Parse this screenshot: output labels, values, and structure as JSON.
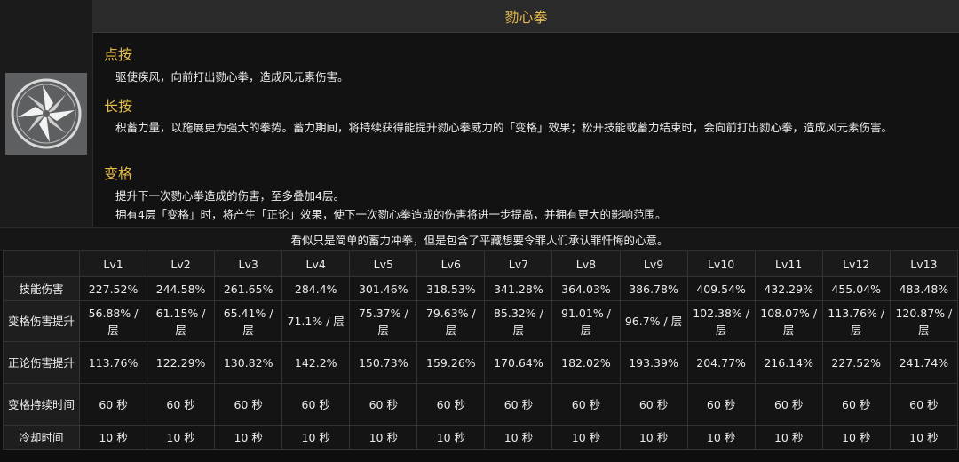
{
  "skill": {
    "title": "勠心拳",
    "sections": [
      {
        "heading": "点按",
        "lines": [
          "驱使疾风，向前打出勠心拳，造成风元素伤害。"
        ]
      },
      {
        "heading": "长按",
        "lines": [
          "积蓄力量，以施展更为强大的拳势。蓄力期间，将持续获得能提升勠心拳威力的「变格」效果；松开技能或蓄力结束时，会向前打出勠心拳，造成风元素伤害。"
        ]
      },
      {
        "heading": "变格",
        "lines": [
          "提升下一次勠心拳造成的伤害，至多叠加4层。",
          "拥有4层「变格」时，将产生「正论」效果，使下一次勠心拳造成的伤害将进一步提高，并拥有更大的影响范围。"
        ]
      }
    ],
    "icon": "wind-pinwheel-icon"
  },
  "caption": "看似只是简单的蓄力冲拳，但是包含了平藏想要令罪人们承认罪忏悔的心意。",
  "table": {
    "levels": [
      "Lv1",
      "Lv2",
      "Lv3",
      "Lv4",
      "Lv5",
      "Lv6",
      "Lv7",
      "Lv8",
      "Lv9",
      "Lv10",
      "Lv11",
      "Lv12",
      "Lv13"
    ],
    "rows": [
      {
        "label": "技能伤害",
        "values": [
          "227.52%",
          "244.58%",
          "261.65%",
          "284.4%",
          "301.46%",
          "318.53%",
          "341.28%",
          "364.03%",
          "386.78%",
          "409.54%",
          "432.29%",
          "455.04%",
          "483.48%"
        ]
      },
      {
        "label": "变格伤害提升",
        "values": [
          "56.88% / 层",
          "61.15% / 层",
          "65.41% / 层",
          "71.1% / 层",
          "75.37% / 层",
          "79.63% / 层",
          "85.32% / 层",
          "91.01% / 层",
          "96.7% / 层",
          "102.38% / 层",
          "108.07% / 层",
          "113.76% / 层",
          "120.87% / 层"
        ]
      },
      {
        "label": "正论伤害提升",
        "values": [
          "113.76%",
          "122.29%",
          "130.82%",
          "142.2%",
          "150.73%",
          "159.26%",
          "170.64%",
          "182.02%",
          "193.39%",
          "204.77%",
          "216.14%",
          "227.52%",
          "241.74%"
        ]
      },
      {
        "label": "变格持续时间",
        "values": [
          "60 秒",
          "60 秒",
          "60 秒",
          "60 秒",
          "60 秒",
          "60 秒",
          "60 秒",
          "60 秒",
          "60 秒",
          "60 秒",
          "60 秒",
          "60 秒",
          "60 秒"
        ]
      },
      {
        "label": "冷却时间",
        "values": [
          "10 秒",
          "10 秒",
          "10 秒",
          "10 秒",
          "10 秒",
          "10 秒",
          "10 秒",
          "10 秒",
          "10 秒",
          "10 秒",
          "10 秒",
          "10 秒",
          "10 秒"
        ]
      }
    ]
  },
  "colors": {
    "accent": "#e3b94b",
    "background": "#0e0e0e",
    "icon_bg": "#5d5f61"
  }
}
